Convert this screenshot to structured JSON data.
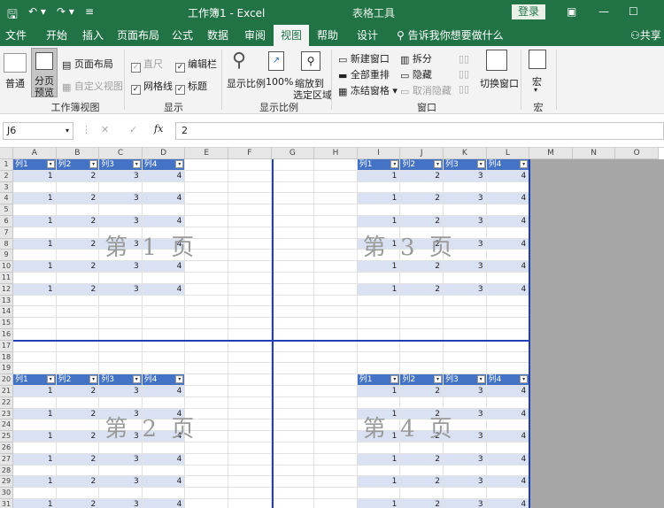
{
  "window": {
    "title": "工作簿1 - Excel",
    "context_tab": "表格工具",
    "login": "登录"
  },
  "tabs": [
    "文件",
    "开始",
    "插入",
    "页面布局",
    "公式",
    "数据",
    "审阅",
    "视图",
    "帮助",
    "设计"
  ],
  "tellme": "告诉我你想要做什么",
  "share": "共享",
  "ribbon": {
    "workbook_views": {
      "normal": "普通",
      "page_break_l1": "分页",
      "page_break_l2": "预览",
      "page_layout": "页面布局",
      "custom_views": "自定义视图",
      "group": "工作簿视图"
    },
    "show": {
      "ruler": "直尺",
      "formula_bar": "编辑栏",
      "gridlines": "网格线",
      "headings": "标题",
      "group": "显示"
    },
    "zoom": {
      "zoom": "显示比例",
      "pct": "100%",
      "sel_l1": "缩放到",
      "sel_l2": "选定区域",
      "group": "显示比例"
    },
    "window": {
      "new": "新建窗口",
      "arrange": "全部重排",
      "freeze": "冻结窗格",
      "split": "拆分",
      "hide": "隐藏",
      "unhide": "取消隐藏",
      "switch": "切换窗口",
      "group": "窗口"
    },
    "macros": {
      "label": "宏",
      "group": "宏"
    }
  },
  "formula_bar": {
    "name_box": "J6",
    "value": "2"
  },
  "columns": [
    "A",
    "B",
    "C",
    "D",
    "E",
    "F",
    "G",
    "H",
    "I",
    "J",
    "K",
    "L",
    "M",
    "N",
    "O"
  ],
  "rows": [
    "1",
    "2",
    "3",
    "4",
    "5",
    "6",
    "7",
    "8",
    "9",
    "10",
    "11",
    "12",
    "13",
    "14",
    "15",
    "16",
    "17",
    "18",
    "19",
    "20",
    "21",
    "22",
    "23",
    "24",
    "25",
    "26",
    "27",
    "28",
    "29",
    "30",
    "31"
  ],
  "table_headers": [
    "列1",
    "列2",
    "列3",
    "列4"
  ],
  "table_values": [
    "1",
    "2",
    "3",
    "4"
  ],
  "pages": [
    "第 1 页",
    "第 3 页",
    "第 2 页",
    "第 4 页"
  ]
}
